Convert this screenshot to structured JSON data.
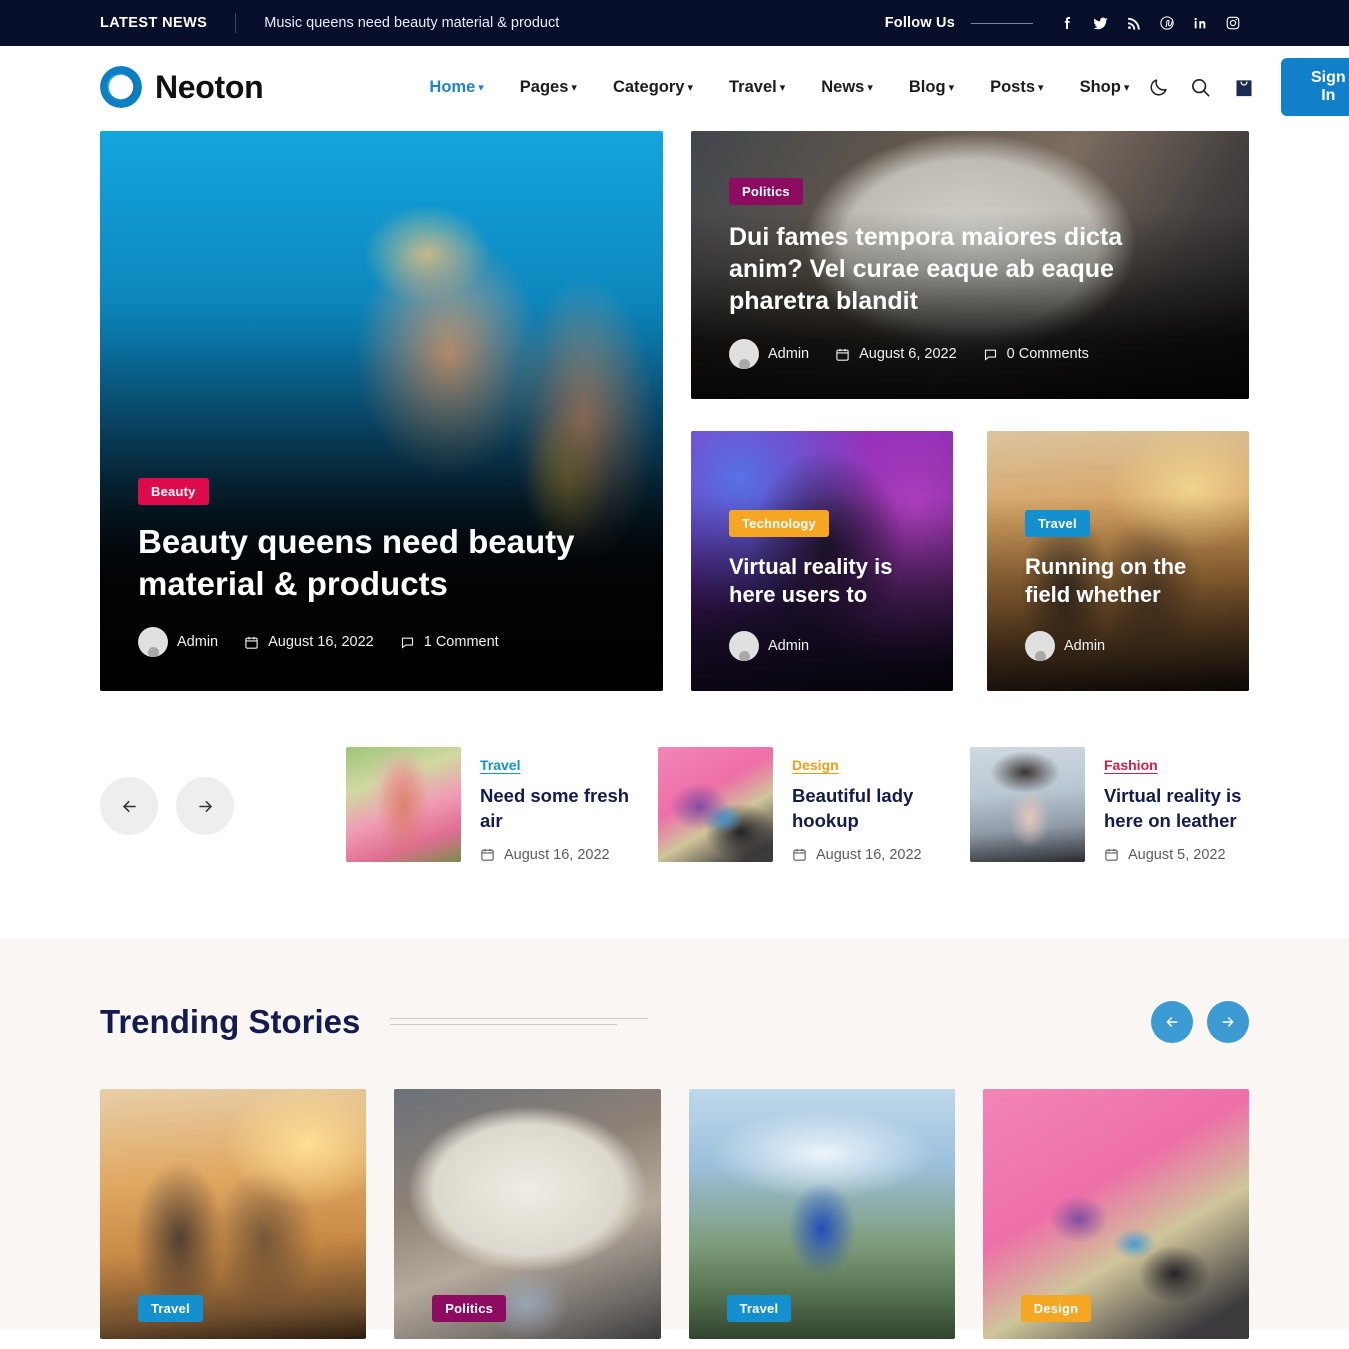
{
  "topbar": {
    "label": "LATEST NEWS",
    "headline": "Music queens need beauty material & product",
    "follow_label": "Follow Us",
    "socials": [
      {
        "name": "facebook-icon"
      },
      {
        "name": "twitter-icon"
      },
      {
        "name": "rss-icon"
      },
      {
        "name": "pinterest-icon"
      },
      {
        "name": "linkedin-icon"
      },
      {
        "name": "instagram-icon"
      }
    ]
  },
  "header": {
    "brand": "Neoton",
    "nav": [
      {
        "label": "Home",
        "active": true
      },
      {
        "label": "Pages",
        "active": false
      },
      {
        "label": "Category",
        "active": false
      },
      {
        "label": "Travel",
        "active": false
      },
      {
        "label": "News",
        "active": false
      },
      {
        "label": "Blog",
        "active": false
      },
      {
        "label": "Posts",
        "active": false
      },
      {
        "label": "Shop",
        "active": false
      }
    ],
    "sign_in": "Sign In",
    "icons": [
      "moon-icon",
      "search-icon",
      "shopping-bag-icon"
    ],
    "accent": "#1280c8"
  },
  "hero": {
    "main": {
      "category": "Beauty",
      "category_color": "#dd0b4c",
      "title": "Beauty queens need beauty material & products",
      "author": "Admin",
      "date": "August 16, 2022",
      "comments": "1 Comment"
    },
    "feature": {
      "category": "Politics",
      "category_color": "#8d0b60",
      "title": "Dui fames tempora maiores dicta anim? Vel curae eaque ab eaque pharetra blandit",
      "author": "Admin",
      "date": "August 6, 2022",
      "comments": "0 Comments"
    },
    "small": [
      {
        "category": "Technology",
        "category_color": "#f5a623",
        "title": "Virtual reality is here users to",
        "author": "Admin"
      },
      {
        "category": "Travel",
        "category_color": "#1590cf",
        "title": "Running on the field whether",
        "author": "Admin"
      }
    ]
  },
  "strip": {
    "prev_label": "Previous",
    "next_label": "Next",
    "items": [
      {
        "category": "Travel",
        "category_color": "#1590cf",
        "title": "Need some fresh air",
        "date": "August 16, 2022"
      },
      {
        "category": "Design",
        "category_color": "#e8a117",
        "title": "Beautiful lady hookup",
        "date": "August 16, 2022"
      },
      {
        "category": "Fashion",
        "category_color": "#d51b46",
        "title": "Virtual reality is here on leather",
        "date": "August 5, 2022"
      }
    ]
  },
  "trending": {
    "title": "Trending Stories",
    "prev_label": "Previous",
    "next_label": "Next",
    "cards": [
      {
        "category": "Travel",
        "category_color": "#1590cf"
      },
      {
        "category": "Politics",
        "category_color": "#8d0b60"
      },
      {
        "category": "Travel",
        "category_color": "#1590cf"
      },
      {
        "category": "Design",
        "category_color": "#f5a623"
      }
    ]
  }
}
